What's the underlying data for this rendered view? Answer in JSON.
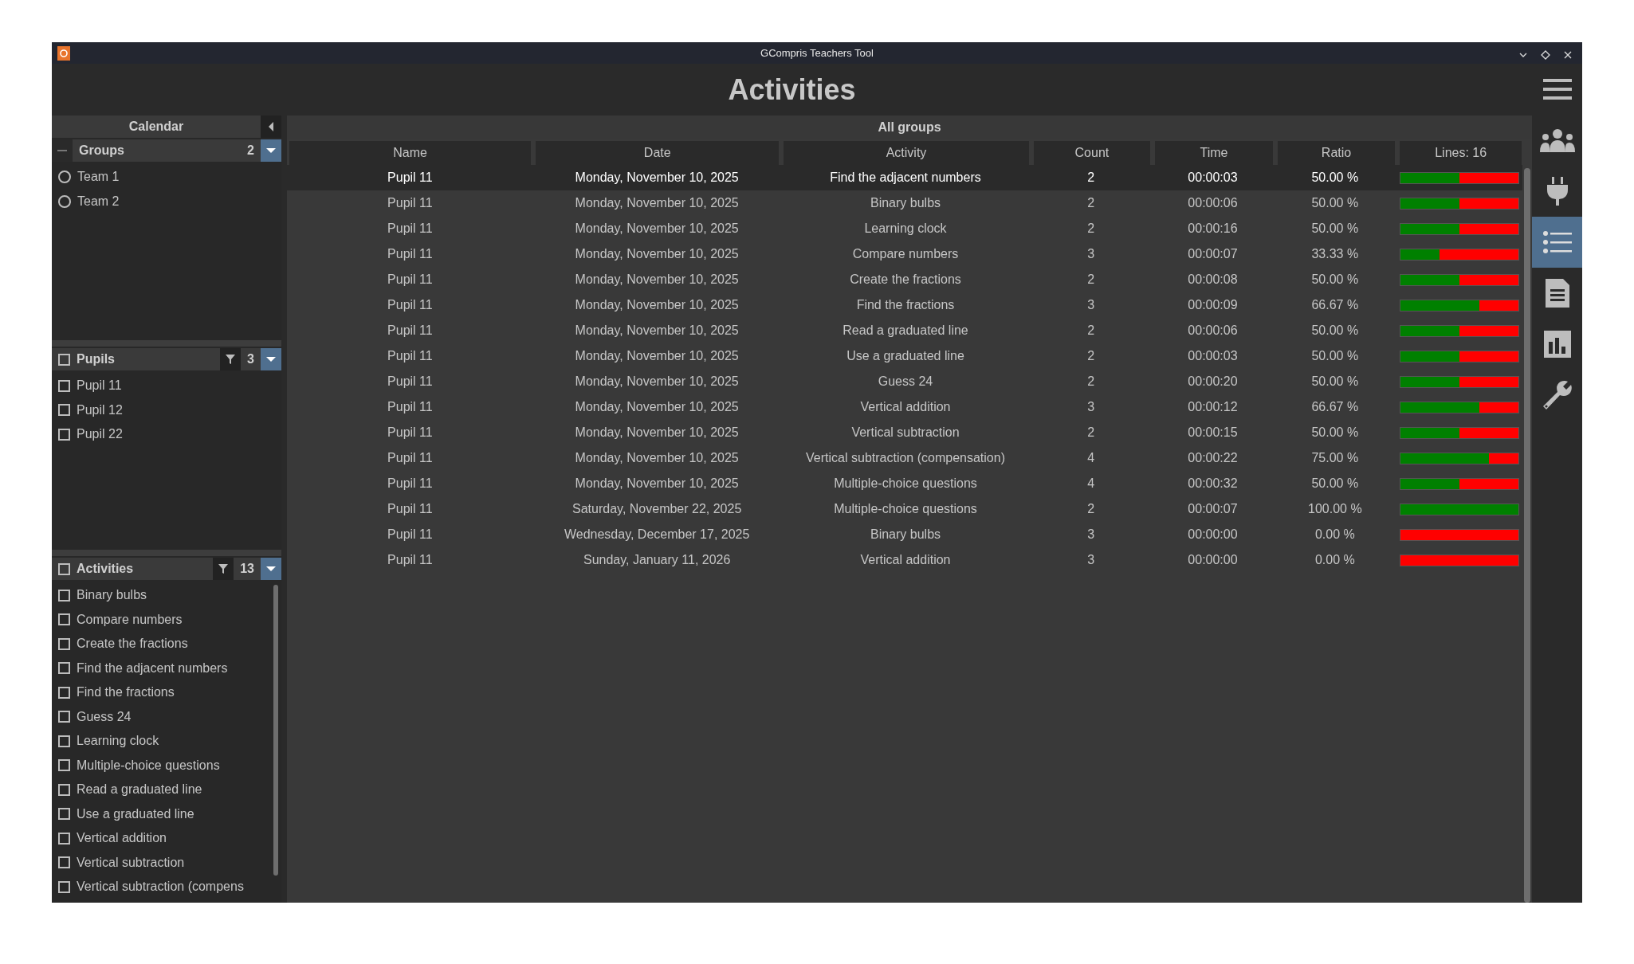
{
  "window": {
    "title": "GCompris Teachers Tool"
  },
  "page_title": "Activities",
  "calendar": {
    "label": "Calendar"
  },
  "groups": {
    "label": "Groups",
    "count": "2",
    "items": [
      {
        "label": "Team 1",
        "selected": false
      },
      {
        "label": "Team 2",
        "selected": false
      }
    ]
  },
  "pupils": {
    "label": "Pupils",
    "count": "3",
    "checked": false,
    "items": [
      {
        "label": "Pupil 11",
        "checked": false
      },
      {
        "label": "Pupil 12",
        "checked": false
      },
      {
        "label": "Pupil 22",
        "checked": false
      }
    ]
  },
  "activities": {
    "label": "Activities",
    "count": "13",
    "checked": false,
    "items": [
      {
        "label": "Binary bulbs",
        "checked": false
      },
      {
        "label": "Compare numbers",
        "checked": false
      },
      {
        "label": "Create the fractions",
        "checked": false
      },
      {
        "label": "Find the adjacent numbers",
        "checked": false
      },
      {
        "label": "Find the fractions",
        "checked": false
      },
      {
        "label": "Guess 24",
        "checked": false
      },
      {
        "label": "Learning clock",
        "checked": false
      },
      {
        "label": "Multiple-choice questions",
        "checked": false
      },
      {
        "label": "Read a graduated line",
        "checked": false
      },
      {
        "label": "Use a graduated line",
        "checked": false
      },
      {
        "label": "Vertical addition",
        "checked": false
      },
      {
        "label": "Vertical subtraction",
        "checked": false
      },
      {
        "label": "Vertical subtraction (compens",
        "checked": false
      }
    ]
  },
  "table": {
    "title": "All groups",
    "columns": [
      "Name",
      "Date",
      "Activity",
      "Count",
      "Time",
      "Ratio",
      "Lines: 16"
    ],
    "rows": [
      {
        "name": "Pupil 11",
        "date": "Monday, November 10, 2025",
        "activity": "Find the adjacent numbers",
        "count": "2",
        "time": "00:00:03",
        "ratio": "50.00 %",
        "level": 0.5,
        "selected": true
      },
      {
        "name": "Pupil 11",
        "date": "Monday, November 10, 2025",
        "activity": "Binary bulbs",
        "count": "2",
        "time": "00:00:06",
        "ratio": "50.00 %",
        "level": 0.5,
        "selected": false
      },
      {
        "name": "Pupil 11",
        "date": "Monday, November 10, 2025",
        "activity": "Learning clock",
        "count": "2",
        "time": "00:00:16",
        "ratio": "50.00 %",
        "level": 0.5,
        "selected": false
      },
      {
        "name": "Pupil 11",
        "date": "Monday, November 10, 2025",
        "activity": "Compare numbers",
        "count": "3",
        "time": "00:00:07",
        "ratio": "33.33 %",
        "level": 0.3333,
        "selected": false
      },
      {
        "name": "Pupil 11",
        "date": "Monday, November 10, 2025",
        "activity": "Create the fractions",
        "count": "2",
        "time": "00:00:08",
        "ratio": "50.00 %",
        "level": 0.5,
        "selected": false
      },
      {
        "name": "Pupil 11",
        "date": "Monday, November 10, 2025",
        "activity": "Find the fractions",
        "count": "3",
        "time": "00:00:09",
        "ratio": "66.67 %",
        "level": 0.6667,
        "selected": false
      },
      {
        "name": "Pupil 11",
        "date": "Monday, November 10, 2025",
        "activity": "Read a graduated line",
        "count": "2",
        "time": "00:00:06",
        "ratio": "50.00 %",
        "level": 0.5,
        "selected": false
      },
      {
        "name": "Pupil 11",
        "date": "Monday, November 10, 2025",
        "activity": "Use a graduated line",
        "count": "2",
        "time": "00:00:03",
        "ratio": "50.00 %",
        "level": 0.5,
        "selected": false
      },
      {
        "name": "Pupil 11",
        "date": "Monday, November 10, 2025",
        "activity": "Guess 24",
        "count": "2",
        "time": "00:00:20",
        "ratio": "50.00 %",
        "level": 0.5,
        "selected": false
      },
      {
        "name": "Pupil 11",
        "date": "Monday, November 10, 2025",
        "activity": "Vertical addition",
        "count": "3",
        "time": "00:00:12",
        "ratio": "66.67 %",
        "level": 0.6667,
        "selected": false
      },
      {
        "name": "Pupil 11",
        "date": "Monday, November 10, 2025",
        "activity": "Vertical subtraction",
        "count": "2",
        "time": "00:00:15",
        "ratio": "50.00 %",
        "level": 0.5,
        "selected": false
      },
      {
        "name": "Pupil 11",
        "date": "Monday, November 10, 2025",
        "activity": "Vertical subtraction (compensation)",
        "count": "4",
        "time": "00:00:22",
        "ratio": "75.00 %",
        "level": 0.75,
        "selected": false
      },
      {
        "name": "Pupil 11",
        "date": "Monday, November 10, 2025",
        "activity": "Multiple-choice questions",
        "count": "4",
        "time": "00:00:32",
        "ratio": "50.00 %",
        "level": 0.5,
        "selected": false
      },
      {
        "name": "Pupil 11",
        "date": "Saturday, November 22, 2025",
        "activity": "Multiple-choice questions",
        "count": "2",
        "time": "00:00:07",
        "ratio": "100.00 %",
        "level": 1,
        "selected": false
      },
      {
        "name": "Pupil 11",
        "date": "Wednesday, December 17, 2025",
        "activity": "Binary bulbs",
        "count": "3",
        "time": "00:00:00",
        "ratio": "0.00 %",
        "level": 0,
        "selected": false
      },
      {
        "name": "Pupil 11",
        "date": "Sunday, January 11, 2026",
        "activity": "Vertical addition",
        "count": "3",
        "time": "00:00:00",
        "ratio": "0.00 %",
        "level": 0,
        "selected": false
      }
    ]
  },
  "toolbar": {
    "items": [
      {
        "selected": false
      },
      {
        "selected": false
      },
      {
        "selected": true
      },
      {
        "selected": false
      },
      {
        "selected": false
      },
      {
        "selected": false
      }
    ]
  }
}
